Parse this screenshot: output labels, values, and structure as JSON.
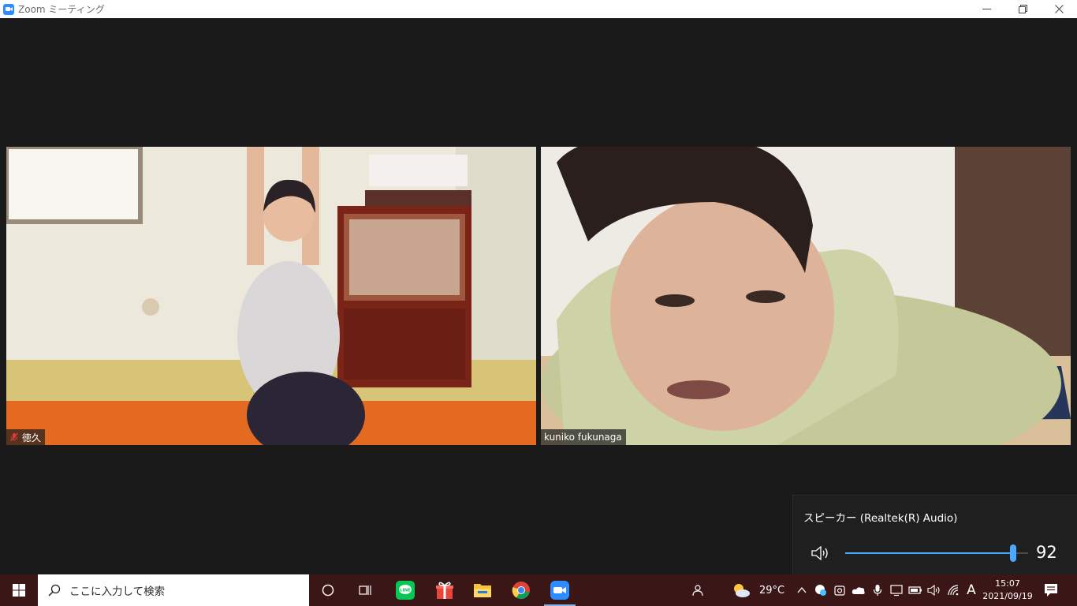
{
  "window": {
    "title": "Zoom ミーティング"
  },
  "participants": [
    {
      "name": "徳久",
      "muted": true
    },
    {
      "name": "kuniko fukunaga",
      "muted": false
    }
  ],
  "volume_flyout": {
    "device": "スピーカー (Realtek(R) Audio)",
    "level": 92,
    "level_label": "92"
  },
  "taskbar": {
    "search_placeholder": "ここに入力して検索",
    "apps": [
      "cortana-icon",
      "task-view-icon",
      "line-app-icon",
      "gift-app-icon",
      "file-explorer-icon",
      "chrome-icon",
      "zoom-icon"
    ],
    "weather": {
      "temp": "29°C"
    },
    "ime": "A",
    "time": "15:07",
    "date": "2021/09/19"
  },
  "colors": {
    "accent": "#4aa8ff",
    "taskbar": "#3b1616",
    "zoom_blue": "#2d8cff",
    "line_green": "#06c755"
  }
}
